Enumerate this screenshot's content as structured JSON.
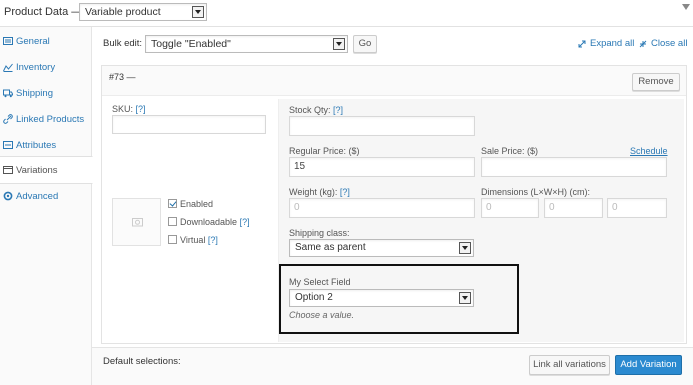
{
  "header": {
    "title": "Product Data —",
    "product_type": "Variable product"
  },
  "sidebar": {
    "items": [
      {
        "label": "General",
        "icon": "general-icon"
      },
      {
        "label": "Inventory",
        "icon": "inventory-icon"
      },
      {
        "label": "Shipping",
        "icon": "truck-icon"
      },
      {
        "label": "Linked Products",
        "icon": "link-icon"
      },
      {
        "label": "Attributes",
        "icon": "attributes-icon"
      },
      {
        "label": "Variations",
        "icon": "variations-icon",
        "active": true
      },
      {
        "label": "Advanced",
        "icon": "gear-icon"
      }
    ]
  },
  "bulk": {
    "label": "Bulk edit:",
    "selected": "Toggle \"Enabled\"",
    "go_label": "Go",
    "expand_all": "Expand all",
    "close_all": "Close all"
  },
  "variation": {
    "number": "#73 —",
    "remove_label": "Remove",
    "sku_label": "SKU:",
    "sku_help": "[?]",
    "sku_value": "",
    "enabled_label": "Enabled",
    "enabled_checked": true,
    "downloadable_label": "Downloadable",
    "downloadable_help": "[?]",
    "virtual_label": "Virtual",
    "virtual_help": "[?]",
    "stock_label": "Stock Qty:",
    "stock_help": "[?]",
    "stock_value": "",
    "regular_price_label": "Regular Price: ($)",
    "regular_price_value": "15",
    "sale_price_label": "Sale Price: ($)",
    "schedule_label": "Schedule",
    "sale_price_value": "",
    "weight_label": "Weight (kg):",
    "weight_help": "[?]",
    "weight_placeholder": "0",
    "dimensions_label": "Dimensions (L×W×H) (cm):",
    "length_placeholder": "0",
    "width_placeholder": "0",
    "height_placeholder": "0",
    "shipping_class_label": "Shipping class:",
    "shipping_class_value": "Same as parent",
    "custom_field_label": "My Select Field",
    "custom_field_value": "Option 2",
    "custom_field_description": "Choose a value."
  },
  "footer": {
    "default_selections": "Default selections:",
    "link_all_label": "Link all variations",
    "add_variation_label": "Add Variation"
  },
  "colors": {
    "link": "#2a78b4",
    "primary_button": "#2b8ad0",
    "highlight_border": "#111111"
  }
}
